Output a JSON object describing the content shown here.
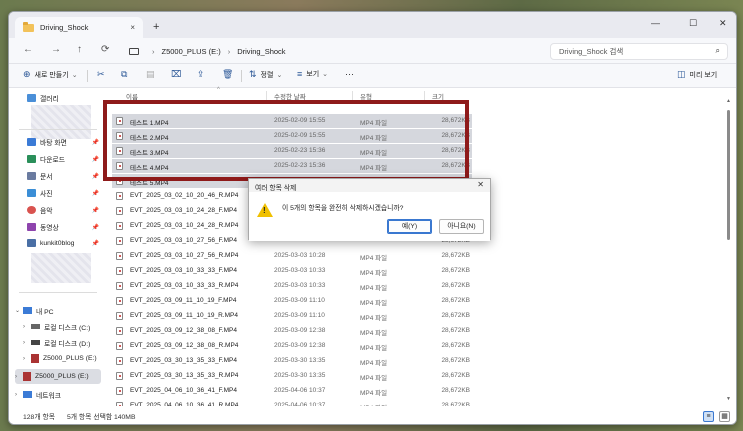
{
  "window": {
    "tab_title": "Driving_Shock",
    "tab_close": "×",
    "new_tab": "+",
    "controls": {
      "minimize": "—",
      "maximize": "☐",
      "close": "✕"
    }
  },
  "address": {
    "back": "←",
    "forward": "→",
    "up": "↑",
    "refresh": "⟳",
    "breadcrumb": [
      "Z5000_PLUS (E:)",
      "Driving_Shock"
    ],
    "search_placeholder": "Driving_Shock 검색"
  },
  "toolbar": {
    "new": "새로 만들기",
    "sort": "정렬",
    "view": "보기",
    "more": "···",
    "details_pane": "미리 보기"
  },
  "sidebar": {
    "gallery": "갤러리",
    "pinned": [
      {
        "label": "바탕 화면",
        "color": "#3b7bd6"
      },
      {
        "label": "다운로드",
        "color": "#2a8f5a"
      },
      {
        "label": "문서",
        "color": "#6a7ba0"
      },
      {
        "label": "사진",
        "color": "#3b8ed6"
      },
      {
        "label": "음악",
        "color": "#d9534f"
      },
      {
        "label": "동영상",
        "color": "#8e44ad"
      },
      {
        "label": "kunkit0blog",
        "color": "#4a6fa5"
      }
    ],
    "tree": [
      {
        "label": "내 PC",
        "arrow": "⌄",
        "selected": false
      },
      {
        "label": "로컬 디스크 (C:)",
        "arrow": "›",
        "selected": false
      },
      {
        "label": "로컬 디스크 (D:)",
        "arrow": "›",
        "selected": false
      },
      {
        "label": "Z5000_PLUS (E:)",
        "arrow": "›",
        "selected": false
      },
      {
        "label": "Z5000_PLUS (E:)",
        "arrow": "›",
        "selected": true
      },
      {
        "label": "네트워크",
        "arrow": "›",
        "selected": false
      }
    ]
  },
  "columns": {
    "name": "이름",
    "date": "수정한 날짜",
    "type": "유형",
    "size": "크기"
  },
  "files": [
    {
      "name": "테스트 1.MP4",
      "date": "2025-02-09 15:55",
      "type": "MP4 파일",
      "size": "28,672KB",
      "selected": true
    },
    {
      "name": "테스트 2.MP4",
      "date": "2025-02-09 15:55",
      "type": "MP4 파일",
      "size": "28,672KB",
      "selected": true
    },
    {
      "name": "테스트 3.MP4",
      "date": "2025-02-23 15:36",
      "type": "MP4 파일",
      "size": "28,672KB",
      "selected": true
    },
    {
      "name": "테스트 4.MP4",
      "date": "2025-02-23 15:36",
      "type": "MP4 파일",
      "size": "28,672KB",
      "selected": true
    },
    {
      "name": "테스트 5.MP4",
      "date": "2025-03-02 10:21",
      "type": "MP4 파일",
      "size": "28,672KB",
      "selected": true
    },
    {
      "name": "EVT_2025_03_02_10_20_46_R.MP4",
      "date": "",
      "type": "",
      "size": "",
      "selected": false
    },
    {
      "name": "EVT_2025_03_03_10_24_28_F.MP4",
      "date": "",
      "type": "",
      "size": "",
      "selected": false
    },
    {
      "name": "EVT_2025_03_03_10_24_28_R.MP4",
      "date": "",
      "type": "",
      "size": "",
      "selected": false
    },
    {
      "name": "EVT_2025_03_03_10_27_56_F.MP4",
      "date": "",
      "type": "",
      "size": "28,672KB",
      "selected": false
    },
    {
      "name": "EVT_2025_03_03_10_27_56_R.MP4",
      "date": "2025-03-03 10:28",
      "type": "MP4 파일",
      "size": "28,672KB",
      "selected": false
    },
    {
      "name": "EVT_2025_03_03_10_33_33_F.MP4",
      "date": "2025-03-03 10:33",
      "type": "MP4 파일",
      "size": "28,672KB",
      "selected": false
    },
    {
      "name": "EVT_2025_03_03_10_33_33_R.MP4",
      "date": "2025-03-03 10:33",
      "type": "MP4 파일",
      "size": "28,672KB",
      "selected": false
    },
    {
      "name": "EVT_2025_03_09_11_10_19_F.MP4",
      "date": "2025-03-09 11:10",
      "type": "MP4 파일",
      "size": "28,672KB",
      "selected": false
    },
    {
      "name": "EVT_2025_03_09_11_10_19_R.MP4",
      "date": "2025-03-09 11:10",
      "type": "MP4 파일",
      "size": "28,672KB",
      "selected": false
    },
    {
      "name": "EVT_2025_03_09_12_38_08_F.MP4",
      "date": "2025-03-09 12:38",
      "type": "MP4 파일",
      "size": "28,672KB",
      "selected": false
    },
    {
      "name": "EVT_2025_03_09_12_38_08_R.MP4",
      "date": "2025-03-09 12:38",
      "type": "MP4 파일",
      "size": "28,672KB",
      "selected": false
    },
    {
      "name": "EVT_2025_03_30_13_35_33_F.MP4",
      "date": "2025-03-30 13:35",
      "type": "MP4 파일",
      "size": "28,672KB",
      "selected": false
    },
    {
      "name": "EVT_2025_03_30_13_35_33_R.MP4",
      "date": "2025-03-30 13:35",
      "type": "MP4 파일",
      "size": "28,672KB",
      "selected": false
    },
    {
      "name": "EVT_2025_04_06_10_36_41_F.MP4",
      "date": "2025-04-06 10:37",
      "type": "MP4 파일",
      "size": "28,672KB",
      "selected": false
    },
    {
      "name": "EVT_2025_04_06_10_36_41_R.MP4",
      "date": "2025-04-06 10:37",
      "type": "MP4 파일",
      "size": "28,672KB",
      "selected": false
    }
  ],
  "status": {
    "count": "128개 항목",
    "selection": "5개 항목 선택함 140MB"
  },
  "dialog": {
    "title": "여러 항목 삭제",
    "close": "✕",
    "message": "이 5개의 항목을 완전히 삭제하시겠습니까?",
    "yes": "예(Y)",
    "no": "아니요(N)",
    "warn_glyph": "!"
  },
  "colors": {
    "selection_row": "#d5d7dd",
    "highlight_border": "#8e1a1a",
    "accent": "#3a78d0",
    "warning": "#f0c000"
  }
}
